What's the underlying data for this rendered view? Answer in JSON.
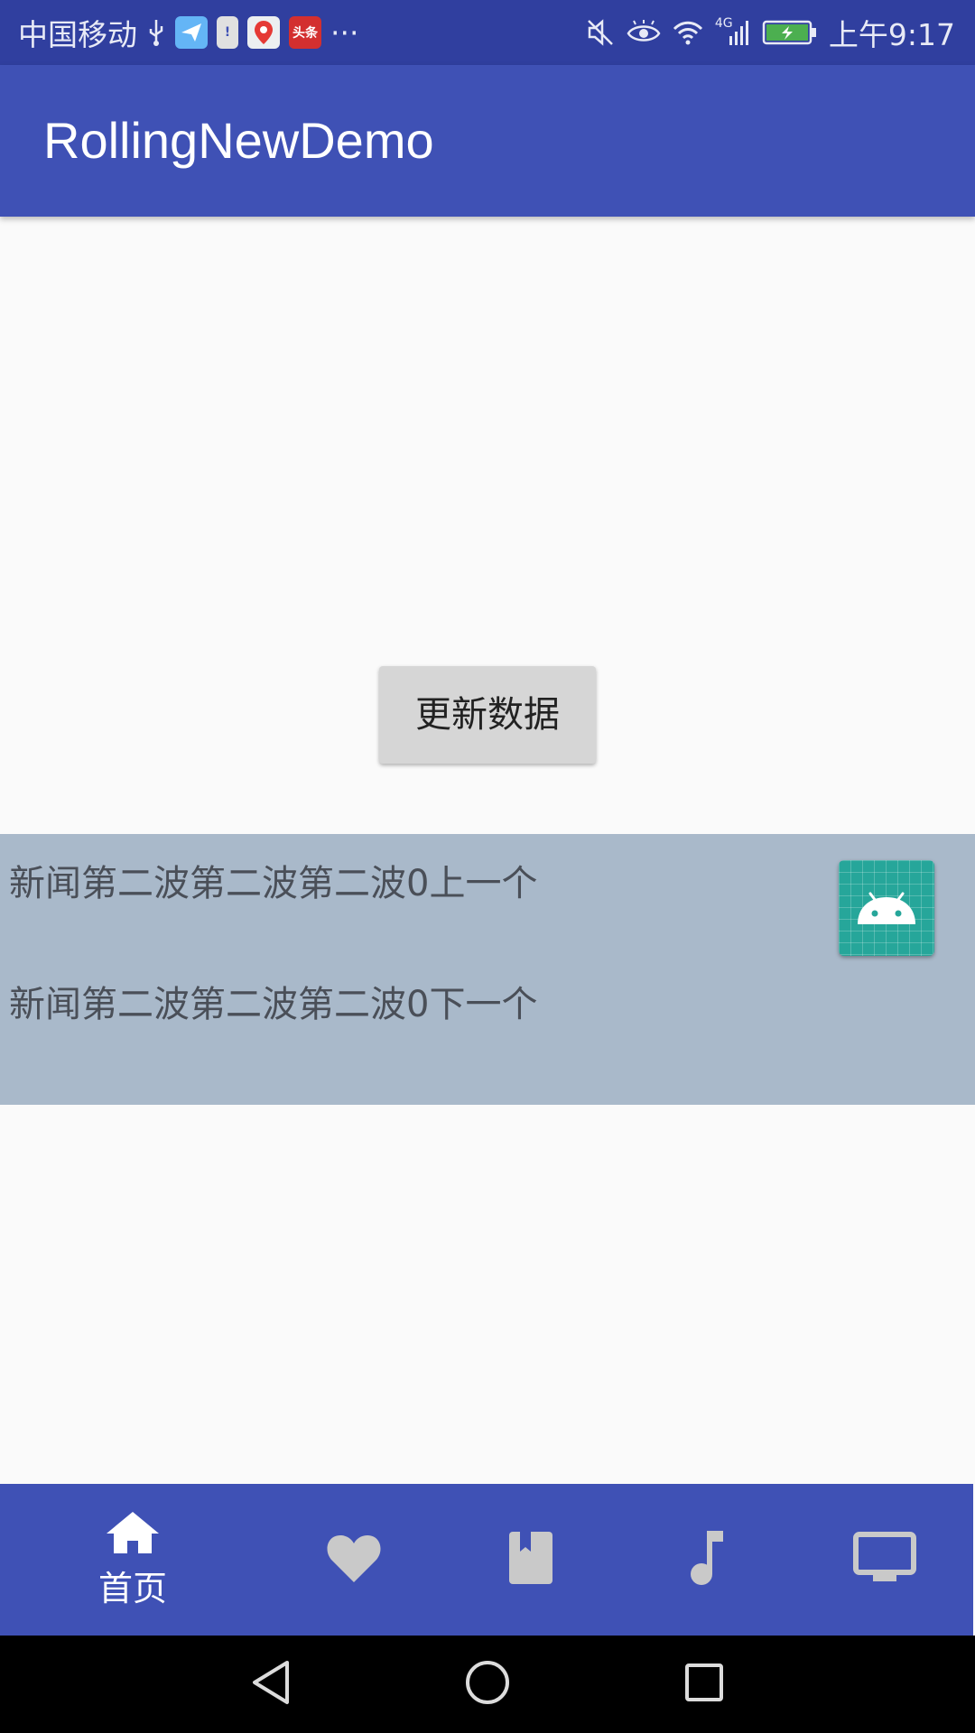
{
  "status_bar": {
    "carrier": "中国移动",
    "network": "4G",
    "time": "上午9:17",
    "notification_icons": [
      "usb-icon",
      "paper-plane-app-icon",
      "alert-app-icon",
      "maps-app-icon",
      "toutiao-app-icon",
      "more-dots-icon"
    ],
    "toutiao_text": "头条",
    "more": "···",
    "right_icons": [
      "mute-icon",
      "eye-icon",
      "wifi-icon",
      "signal-icon",
      "battery-charging-icon"
    ]
  },
  "app_bar": {
    "title": "RollingNewDemo"
  },
  "main": {
    "update_button_label": "更新数据"
  },
  "news": {
    "prev_text": "新闻第二波第二波第二波0上一个",
    "next_text": "新闻第二波第二波第二波0下一个",
    "icon": "android-icon"
  },
  "bottom_nav": {
    "items": [
      {
        "icon": "home-icon",
        "label": "首页",
        "selected": true
      },
      {
        "icon": "heart-icon",
        "label": "",
        "selected": false
      },
      {
        "icon": "book-icon",
        "label": "",
        "selected": false
      },
      {
        "icon": "music-note-icon",
        "label": "",
        "selected": false
      },
      {
        "icon": "tv-icon",
        "label": "",
        "selected": false
      }
    ]
  },
  "colors": {
    "status_bar": "#303f9f",
    "primary": "#3f51b5",
    "news_panel": "#a9b9ca",
    "badge": "#26a69a",
    "inactive_nav_icon": "#c9c9c9"
  },
  "system_nav": {
    "buttons": [
      "back-icon",
      "home-circle-icon",
      "recents-icon"
    ]
  }
}
